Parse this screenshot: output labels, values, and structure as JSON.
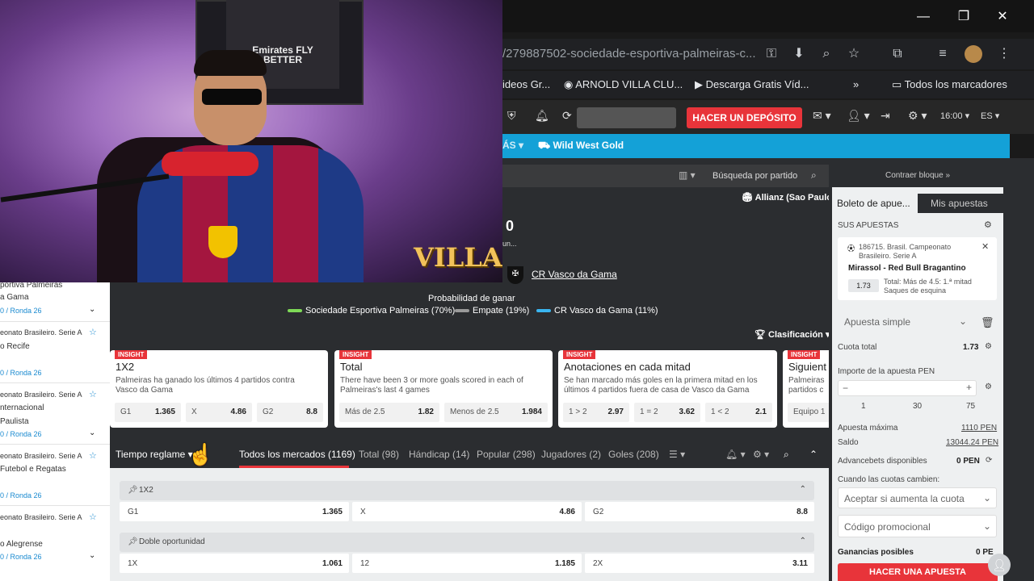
{
  "browser": {
    "url": "/279887502-sociedade-esportiva-palmeiras-c...",
    "bookmarks": [
      "ideos Gr...",
      "ARNOLD VILLA CLU...",
      "Descarga Gratis Víd...",
      "Todos los marcadores"
    ]
  },
  "header": {
    "deposit_label": "HACER UN DEPÓSITO",
    "time": "16:00",
    "lang": "ES",
    "nav_more": "ÁS",
    "nav_game": "Wild West Gold"
  },
  "match": {
    "search_placeholder": "Búsqueda por partido",
    "venue": "Allianz (Sao Paulo)",
    "score_fragment": "0",
    "score_sub": "un...",
    "away_team": "CR Vasco da Gama",
    "prob_title": "Probabilidad de ganar",
    "prob": [
      {
        "label": "Sociedade Esportiva Palmeiras (70%)",
        "color": "#7ed957"
      },
      {
        "label": "Empate (19%)",
        "color": "#9a9a9a"
      },
      {
        "label": "CR Vasco da Gama (11%)",
        "color": "#3ab5f0"
      }
    ],
    "clasif_label": "Clasificación"
  },
  "insights": [
    {
      "tag": "INSIGHT",
      "title": "1X2",
      "desc": "Palmeiras ha ganado los últimos 4 partidos contra Vasco da Gama",
      "odds": [
        {
          "l": "G1",
          "v": "1.365"
        },
        {
          "l": "X",
          "v": "4.86"
        },
        {
          "l": "G2",
          "v": "8.8"
        }
      ]
    },
    {
      "tag": "INSIGHT",
      "title": "Total",
      "desc": "There have been 3 or more goals scored in each of Palmeiras's last 4 games",
      "odds": [
        {
          "l": "Más de 2.5",
          "v": "1.82"
        },
        {
          "l": "Menos de 2.5",
          "v": "1.984"
        }
      ]
    },
    {
      "tag": "INSIGHT",
      "title": "Anotaciones en cada mitad",
      "desc": "Se han marcado más goles en la primera mitad en los últimos 4 partidos fuera de casa de Vasco da Gama",
      "odds": [
        {
          "l": "1 > 2",
          "v": "2.97"
        },
        {
          "l": "1 = 2",
          "v": "3.62"
        },
        {
          "l": "1 < 2",
          "v": "2.1"
        }
      ]
    },
    {
      "tag": "INSIGHT",
      "title": "Siguient",
      "desc": "Palmeiras partidos c",
      "odds": [
        {
          "l": "Equipo 1",
          "v": ""
        }
      ]
    }
  ],
  "tabs": {
    "time_select": "Tiempo reglame",
    "items": [
      "Todos los mercados (1169)",
      "Total (98)",
      "Hándicap (14)",
      "Popular (298)",
      "Jugadores (2)",
      "Goles (208)"
    ]
  },
  "markets": [
    {
      "title": "1X2",
      "odds": [
        {
          "l": "G1",
          "v": "1.365"
        },
        {
          "l": "X",
          "v": "4.86"
        },
        {
          "l": "G2",
          "v": "8.8"
        }
      ]
    },
    {
      "title": "Doble oportunidad",
      "odds": [
        {
          "l": "1X",
          "v": "1.061"
        },
        {
          "l": "12",
          "v": "1.185"
        },
        {
          "l": "2X",
          "v": "3.11"
        }
      ]
    }
  ],
  "left_list": [
    {
      "t1": "portiva Palmeiras",
      "t2": "a Gama",
      "round": "0 / Ronda 26"
    },
    {
      "t1": "eonato Brasileiro. Serie A",
      "t2": "o Recife",
      "round": "0 / Ronda 26"
    },
    {
      "t1": "eonato Brasileiro. Serie A",
      "t2": "nternacional",
      "t3": "Paulista",
      "round": "0 / Ronda 26"
    },
    {
      "t1": "eonato Brasileiro. Serie A",
      "t2": "Futebol e Regatas",
      "round": "0 / Ronda 26"
    },
    {
      "t1": "eonato Brasileiro. Serie A",
      "t2": "o Alegrense",
      "round": "0 / Ronda 26"
    }
  ],
  "slip": {
    "contraer": "Contraer bloque »",
    "tab_boleto": "Boleto de apue...",
    "tab_mis": "Mis apuestas",
    "sus_apuestas": "SUS APUESTAS",
    "event_league": "186715. Brasil. Campeonato Brasileiro. Serie A",
    "event_match": "Mirassol - Red Bull Bragantino",
    "event_odd": "1.73",
    "event_desc": "Total: Más de 4.5: 1.ª mitad Saques de esquina",
    "bet_type": "Apuesta simple",
    "cuota_total_label": "Cuota total",
    "cuota_total": "1.73",
    "importe_label": "Importe de la apuesta PEN",
    "quick": [
      "1",
      "30",
      "75"
    ],
    "max_label": "Apuesta máxima",
    "max_val": "1110 PEN",
    "saldo_label": "Saldo",
    "saldo_val": "13044.24 PEN",
    "advance_label": "Advancebets disponibles",
    "advance_val": "0 PEN",
    "cambio_label": "Cuando las cuotas cambien:",
    "cambio_val": "Aceptar si aumenta la cuota",
    "promo": "Código promocional",
    "ganancias_label": "Ganancias posibles",
    "ganancias_val": "0 PE",
    "submit": "HACER UNA APUESTA"
  },
  "webcam": {
    "overlay_text": "VILLA",
    "shirt_text": "Emirates FLY BETTER"
  }
}
